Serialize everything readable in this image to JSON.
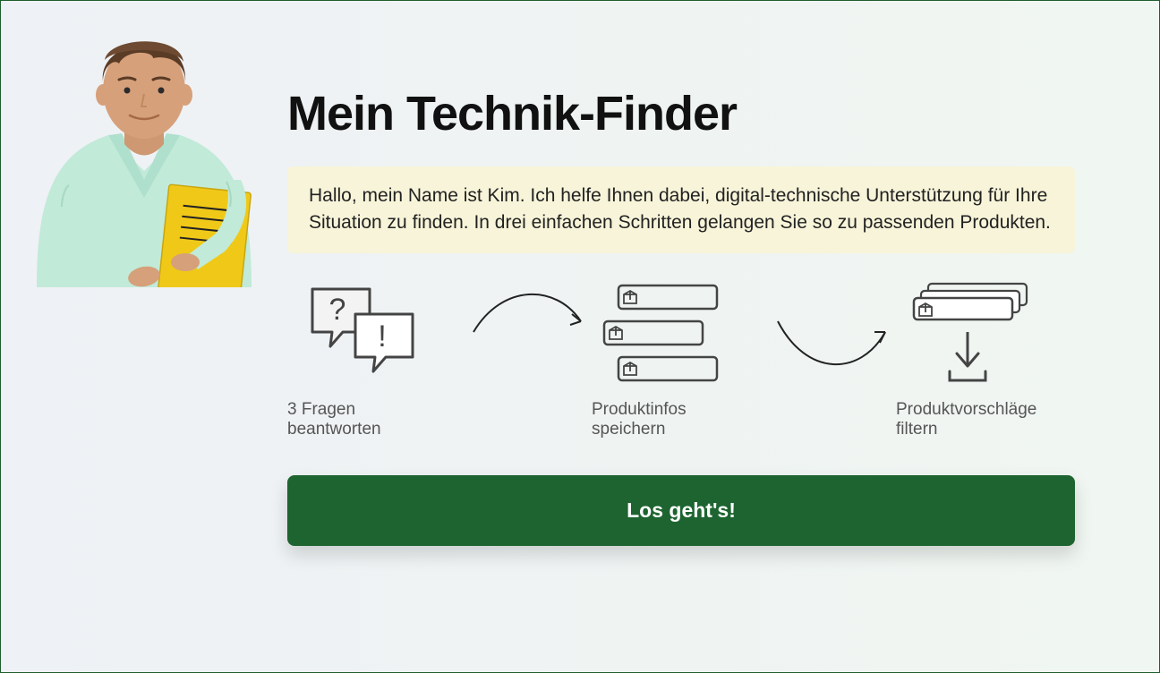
{
  "page": {
    "title": "Mein Technik-Finder",
    "intro_text": "Hallo, mein Name ist Kim. Ich helfe Ihnen dabei, digital-technische Unterstützung für Ihre Situation zu finden. In drei einfachen Schritten gelangen Sie so zu passenden Produkten."
  },
  "steps": [
    {
      "label": "3 Fragen beantworten"
    },
    {
      "label": "Produktinfos speichern"
    },
    {
      "label": "Produktvorschläge filtern"
    }
  ],
  "cta": {
    "label": "Los geht's!"
  },
  "colors": {
    "accent_green": "#1d6430",
    "intro_bg": "#f7f4d9"
  }
}
